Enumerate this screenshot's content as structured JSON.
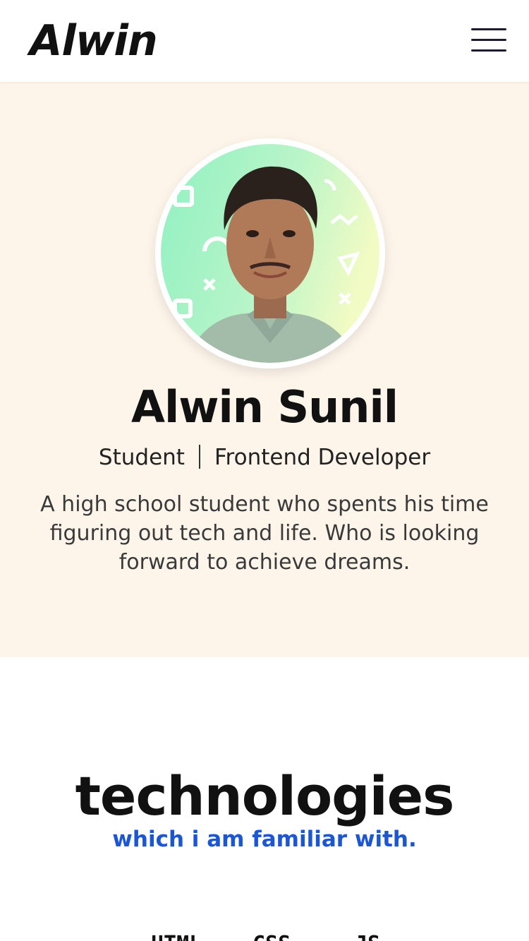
{
  "header": {
    "logo": "Alwin",
    "menu_icon": "hamburger-menu-icon"
  },
  "hero": {
    "photo": "profile-photo",
    "name": "Alwin Sunil",
    "roles": [
      "Student",
      "Frontend Developer"
    ],
    "bio": "A high school student who spents his time figuring out tech and life. Who is looking forward to achieve dreams."
  },
  "technologies": {
    "title": "technologies",
    "subtitle": "which i am familiar with.",
    "items": [
      "HTML",
      "CSS",
      "JS"
    ]
  },
  "colors": {
    "hero_bg": "#fdf4ea",
    "accent": "#1a56d6",
    "text": "#111111"
  }
}
